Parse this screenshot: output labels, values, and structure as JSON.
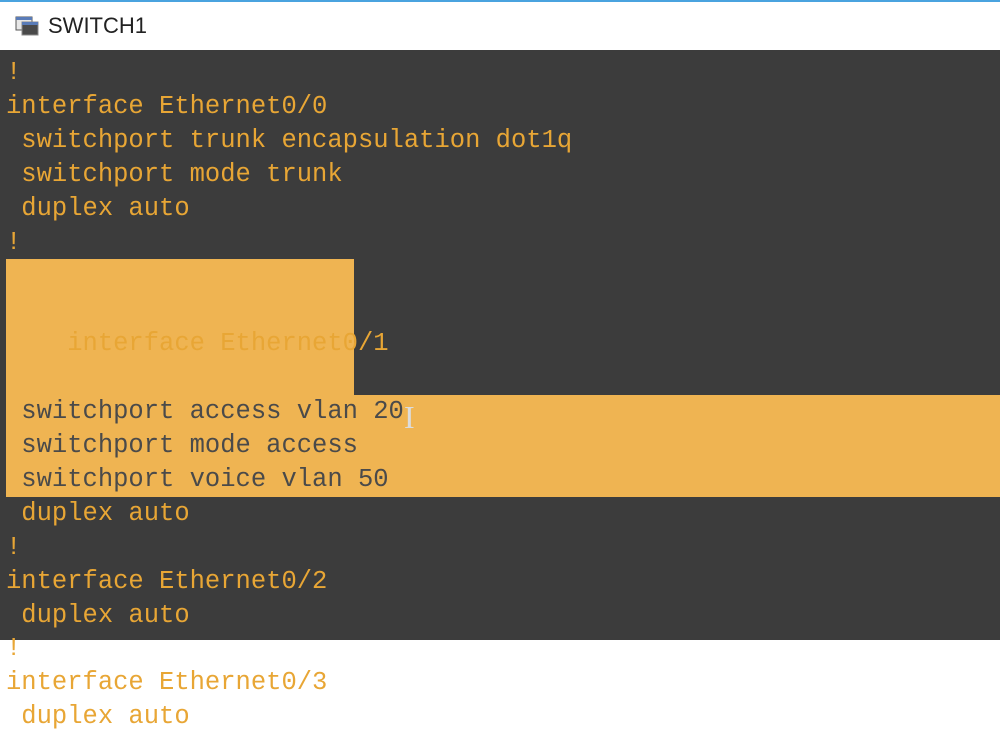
{
  "window": {
    "title": "SWITCH1"
  },
  "terminal": {
    "lines": [
      {
        "text": "!",
        "highlighted": false
      },
      {
        "text": "interface Ethernet0/0",
        "highlighted": false
      },
      {
        "text": " switchport trunk encapsulation dot1q",
        "highlighted": false
      },
      {
        "text": " switchport mode trunk",
        "highlighted": false
      },
      {
        "text": " duplex auto",
        "highlighted": false
      },
      {
        "text": "!",
        "highlighted": false
      },
      {
        "text": "interface Ethernet0/1",
        "highlighted": "partial"
      },
      {
        "text": " switchport access vlan 20",
        "highlighted": true
      },
      {
        "text": " switchport mode access",
        "highlighted": true
      },
      {
        "text": " switchport voice vlan 50",
        "highlighted": true
      },
      {
        "text": " duplex auto",
        "highlighted": false
      },
      {
        "text": "!",
        "highlighted": false
      },
      {
        "text": "interface Ethernet0/2",
        "highlighted": false
      },
      {
        "text": " duplex auto",
        "highlighted": false
      },
      {
        "text": "!",
        "highlighted": false
      },
      {
        "text": "interface Ethernet0/3",
        "highlighted": false
      },
      {
        "text": " duplex auto",
        "highlighted": false
      }
    ]
  },
  "cursor": {
    "glyph": "I"
  },
  "colors": {
    "terminal_bg": "#3c3c3c",
    "text_normal": "#e8a635",
    "highlight_bg": "#efb452",
    "highlight_text": "#4a4a4a",
    "title_border": "#4aa3df"
  }
}
